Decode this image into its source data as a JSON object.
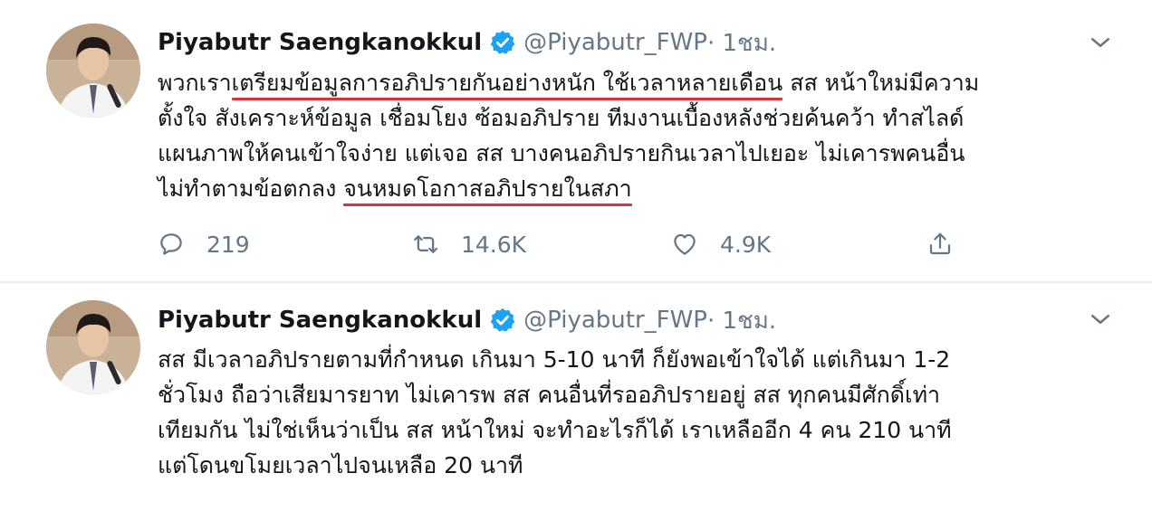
{
  "tweets": [
    {
      "author": {
        "name": "Piyabutr Saengkanokkul",
        "handle": "@Piyabutr_FWP",
        "time": " · 1ชม.",
        "verified": true
      },
      "lines": [
        {
          "a": "พวกเรา",
          "u": "เตรียมข้อมูลการอภิปรายกันอย่างหนัก ใช้เวลาหลายเดือน",
          "b": " สส หน้าใหม่มีความ"
        },
        {
          "a": "ตั้งใจ สังเคราะห์ข้อมูล เชื่อมโยง ซ้อมอภิปราย ทีมงานเบื้องหลังช่วยค้นคว้า ทำสไลด์"
        },
        {
          "a": "แผนภาพให้คนเข้าใจง่าย แต่เจอ สส บางคนอภิปรายกินเวลาไปเยอะ ไม่เคารพคนอื่น"
        },
        {
          "a": "ไม่ทำตามข้อตกลง ",
          "u": "จนหมดโอกาสอภิปรายในสภา"
        }
      ],
      "stats": {
        "replies": "219",
        "retweets": "14.6K",
        "likes": "4.9K"
      }
    },
    {
      "author": {
        "name": "Piyabutr Saengkanokkul",
        "handle": "@Piyabutr_FWP",
        "time": " · 1ชม.",
        "verified": true
      },
      "lines": [
        {
          "a": "สส มีเวลาอภิปรายตามที่กำหนด เกินมา 5-10 นาที ก็ยังพอเข้าใจได้ แต่เกินมา 1-2"
        },
        {
          "a": "ชั่วโมง ถือว่าเสียมารยาท ไม่เคารพ สส คนอื่นที่รออภิปรายอยู่ สส ทุกคนมีศักดิ์เท่า"
        },
        {
          "a": "เทียมกัน ไม่ใช่เห็นว่าเป็น สส หน้าใหม่ จะทำอะไรก็ได้ เราเหลืออีก 4 คน 210 นาที"
        },
        {
          "a": "แต่โดนขโมยเวลาไปจนเหลือ 20 นาที"
        }
      ]
    }
  ],
  "colors": {
    "text": "#14171a",
    "secondary": "#657786",
    "verified": "#1da1f2",
    "underline": "#e0303a",
    "divider": "#e6ecf0"
  },
  "icons": [
    "verified-badge-icon",
    "chevron-down-icon",
    "reply-icon",
    "retweet-icon",
    "like-icon",
    "share-icon"
  ]
}
